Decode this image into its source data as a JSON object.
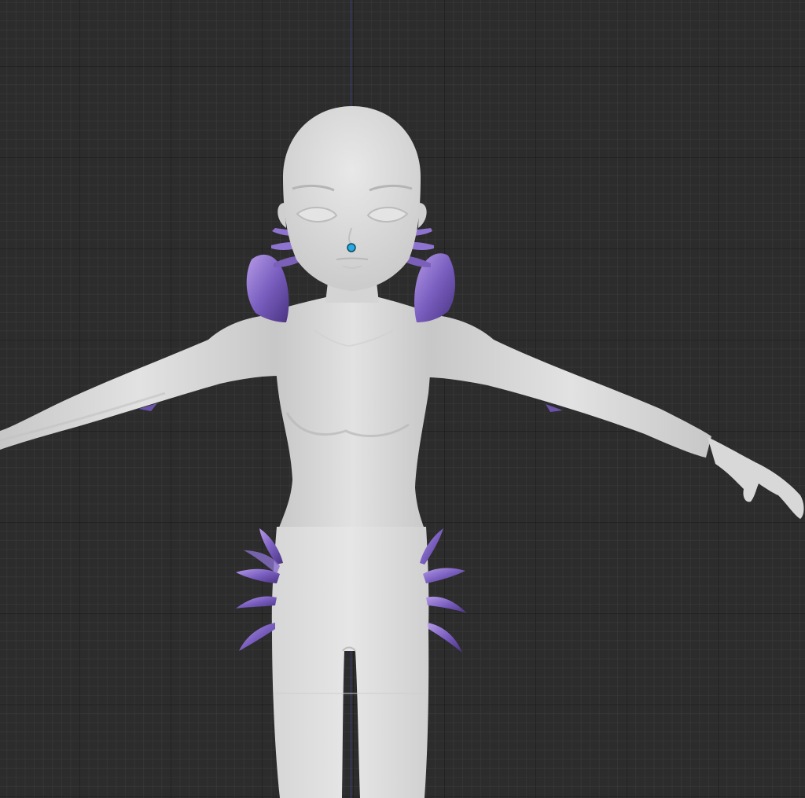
{
  "viewport": {
    "background": "#2c2c2c",
    "grid_minor": "#3a3a3a",
    "grid_major": "#1f1f1f",
    "axis_color": "#3d3f7a"
  },
  "model": {
    "body_color": "#d9d9d9",
    "body_shade": "#bdbdbd",
    "accent_color": "#7a60b8",
    "accent_highlight": "#a58be0",
    "accent_shadow": "#4b3384"
  },
  "origin_point": {
    "color": "#29a9e0",
    "icon": "object-origin-icon"
  }
}
